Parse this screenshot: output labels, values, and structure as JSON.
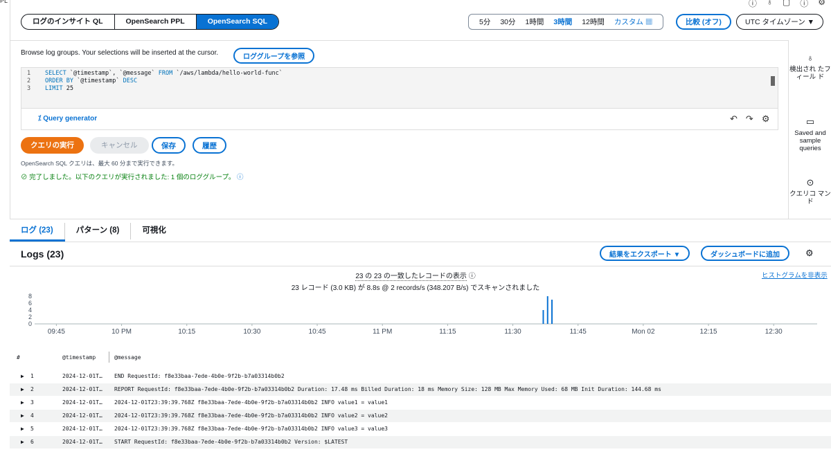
{
  "header": {
    "top_left": "PL",
    "icons": [
      "info-icon",
      "lightbulb-icon",
      "square-icon",
      "info-icon",
      "gear-icon"
    ]
  },
  "query_modes": [
    "ログのインサイト QL",
    "OpenSearch PPL",
    "OpenSearch SQL"
  ],
  "active_mode": "OpenSearch SQL",
  "time_ranges": [
    "5分",
    "30分",
    "1時間",
    "3時間",
    "12時間"
  ],
  "selected_range": "3時間",
  "custom_label": "カスタム",
  "compare_label": "比較 (オフ)",
  "timezone_label": "UTC タイムゾーン ▼",
  "browse_hint": "Browse log groups. Your selections will be inserted at the cursor.",
  "browse_button": "ロググループを参照",
  "editor": {
    "line_numbers": [
      "1",
      "2",
      "3"
    ],
    "lines": [
      {
        "kw1": "SELECT",
        "rest1": " `@timestamp`, `@message` ",
        "kw2": "FROM",
        "rest2": " `/aws/lambda/hello-world-func`"
      },
      {
        "kw1": "ORDER BY",
        "rest1": " `@timestamp` ",
        "kw2": "DESC",
        "rest2": ""
      },
      {
        "kw1": "LIMIT",
        "rest1": " 25",
        "kw2": "",
        "rest2": ""
      }
    ]
  },
  "query_generator": "Query generator",
  "buttons": {
    "run": "クエリの実行",
    "cancel": "キャンセル",
    "save": "保存",
    "history": "履歴"
  },
  "note": "OpenSearch SQL クエリは、最大 60 分まで実行できます。",
  "status": "完了しました。以下のクエリが実行されました: 1 個のロググループ。",
  "side_panel": [
    {
      "icon": "lightbulb-icon",
      "label": "検出され たフィール ド"
    },
    {
      "icon": "folder-icon",
      "label": "Saved and sample queries"
    },
    {
      "icon": "help-icon",
      "label": "クエリコ マンド"
    }
  ],
  "tabs": [
    "ログ (23)",
    "パターン (8)",
    "可視化"
  ],
  "logs_title": "Logs (23)",
  "export_button": "結果をエクスポート ▼",
  "dashboard_button": "ダッシュボードに追加",
  "summary_line1": "23 の 23 の一致したレコードの表示",
  "summary_line2": "23 レコード (3.0 KB) が 8.8s @ 2 records/s (348.207 B/s) でスキャンされました",
  "hide_histogram": "ヒストグラムを非表示",
  "chart_data": {
    "type": "bar",
    "y_ticks": [
      "8",
      "6",
      "4",
      "2",
      "0"
    ],
    "x_ticks": [
      "09:45",
      "10 PM",
      "10:15",
      "10:30",
      "10:45",
      "11 PM",
      "11:15",
      "11:30",
      "11:45",
      "Mon 02",
      "12:15",
      "12:30"
    ],
    "bars": [
      {
        "t": "23:37",
        "value": 4
      },
      {
        "t": "23:38",
        "value": 8
      },
      {
        "t": "23:39",
        "value": 7
      }
    ],
    "ylim": [
      0,
      8
    ]
  },
  "table": {
    "headers": [
      "#",
      "@timestamp",
      "@message"
    ],
    "rows": [
      {
        "n": "1",
        "ts": "2024-12-01T…",
        "msg": "END RequestId: f8e33baa-7ede-4b0e-9f2b-b7a03314b0b2"
      },
      {
        "n": "2",
        "ts": "2024-12-01T…",
        "msg": "REPORT RequestId: f8e33baa-7ede-4b0e-9f2b-b7a03314b0b2 Duration: 17.48 ms Billed Duration: 18 ms Memory Size: 128 MB Max Memory Used: 68 MB Init Duration: 144.68 ms"
      },
      {
        "n": "3",
        "ts": "2024-12-01T…",
        "msg": "2024-12-01T23:39:39.768Z f8e33baa-7ede-4b0e-9f2b-b7a03314b0b2 INFO value1 = value1"
      },
      {
        "n": "4",
        "ts": "2024-12-01T…",
        "msg": "2024-12-01T23:39:39.768Z f8e33baa-7ede-4b0e-9f2b-b7a03314b0b2 INFO value2 = value2"
      },
      {
        "n": "5",
        "ts": "2024-12-01T…",
        "msg": "2024-12-01T23:39:39.768Z f8e33baa-7ede-4b0e-9f2b-b7a03314b0b2 INFO value3 = value3"
      },
      {
        "n": "6",
        "ts": "2024-12-01T…",
        "msg": "START RequestId: f8e33baa-7ede-4b0e-9f2b-b7a03314b0b2 Version: $LATEST"
      }
    ]
  },
  "colors": {
    "accent": "#0972d3",
    "run_button": "#ec7211",
    "success": "#037f0c",
    "bar": "#0972d3"
  }
}
